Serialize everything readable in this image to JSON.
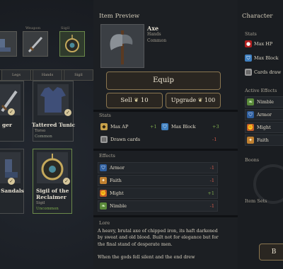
{
  "left": {
    "slot_labels": {
      "weapon": "Weapon",
      "sigil": "Sigil"
    },
    "tabs": [
      "Legs",
      "Hands",
      "Sigil"
    ],
    "cards": [
      {
        "name": "ger",
        "check": "✓"
      },
      {
        "name": "Tattered Tunic",
        "slot": "Torso",
        "rarity": "Common",
        "check": "✓"
      },
      {
        "name": "Sandals",
        "check": "✓"
      },
      {
        "name": "Sigil of the Reclaimer",
        "slot": "Sigil",
        "rarity": "Uncommon",
        "check": "✓"
      }
    ]
  },
  "preview": {
    "title": "Item Preview",
    "item_name": "Axe",
    "item_slot": "Hands",
    "item_rarity": "Common",
    "equip_label": "Equip",
    "sell_label": "Sell",
    "sell_price": "10",
    "upgrade_label": "Upgrade",
    "upgrade_price": "100",
    "stats_label": "Stats",
    "stats": [
      {
        "label": "Max AP",
        "value": "+1",
        "icon": "gem-icon",
        "color": "#c8a24a"
      },
      {
        "label": "Max Block",
        "value": "+3",
        "icon": "shield-icon",
        "color": "#3f7fbf"
      },
      {
        "label": "Drawn cards",
        "value": "-1",
        "icon": "cards-icon",
        "color": "#9a9a9a"
      }
    ],
    "effects_label": "Effects",
    "effects": [
      {
        "label": "Armor",
        "value": "-1",
        "icon": "armor-icon",
        "color": "#2f5f9f"
      },
      {
        "label": "Faith",
        "value": "-1",
        "icon": "faith-icon",
        "color": "#c08030"
      },
      {
        "label": "Might",
        "value": "+1",
        "icon": "might-icon",
        "color": "#c05a2a"
      },
      {
        "label": "Nimble",
        "value": "-1",
        "icon": "nimble-icon",
        "color": "#5a8a3a"
      }
    ],
    "lore_label": "Lore",
    "lore_text": "A heavy, brutal axe of chipped iron, its haft darkened by sweat and old blood. Built not for elegance but for the final stand of desperate men.",
    "lore_more": "When the gods fell silent and the end drew"
  },
  "character": {
    "title": "Character",
    "stats_label": "Stats",
    "stats": [
      {
        "label": "Max HP",
        "icon": "blood-drop-icon",
        "color": "#b02020"
      },
      {
        "label": "Max Block",
        "icon": "shield-icon",
        "color": "#3f7fbf"
      },
      {
        "label": "Cards draw",
        "icon": "cards-icon",
        "color": "#9a9a9a"
      }
    ],
    "active_effects_label": "Active Effects",
    "effects": [
      {
        "label": "Nimble",
        "icon": "nimble-icon",
        "color": "#5a8a3a"
      },
      {
        "label": "Armor",
        "icon": "armor-icon",
        "color": "#2f5f9f"
      },
      {
        "label": "Might",
        "icon": "might-icon",
        "color": "#c05a2a"
      },
      {
        "label": "Faith",
        "icon": "faith-icon",
        "color": "#c08030"
      }
    ],
    "boons_label": "Boons",
    "item_sets_label": "Item Sets",
    "bottom_button": "B"
  }
}
